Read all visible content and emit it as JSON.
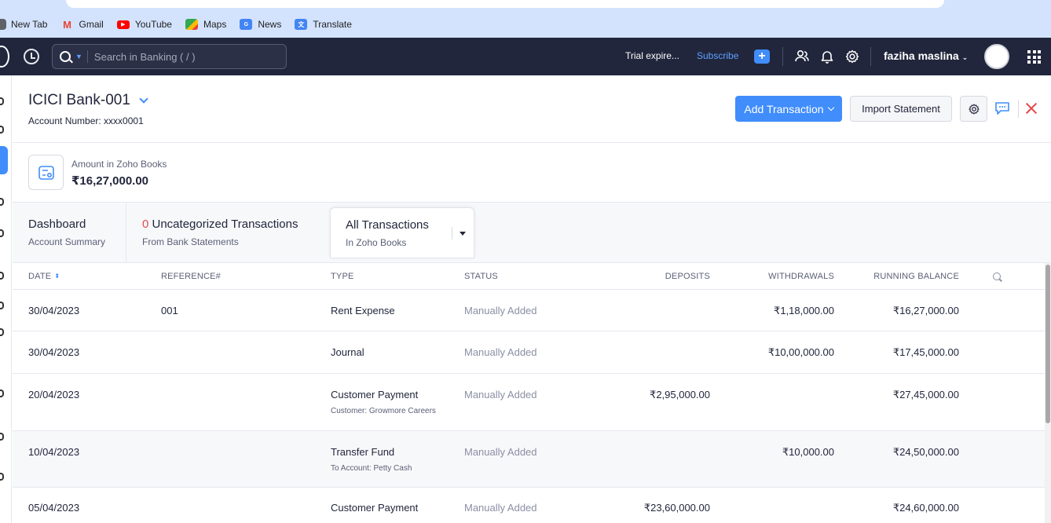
{
  "browser": {
    "bookmarks": [
      {
        "label": "New Tab",
        "icon": "globe-icon",
        "color": "#5f6368"
      },
      {
        "label": "Gmail",
        "icon": "gmail-icon",
        "color": "#ea4335"
      },
      {
        "label": "YouTube",
        "icon": "youtube-icon",
        "color": "#ff0000"
      },
      {
        "label": "Maps",
        "icon": "maps-icon",
        "color": "#34a853"
      },
      {
        "label": "News",
        "icon": "news-icon",
        "color": "#4285f4"
      },
      {
        "label": "Translate",
        "icon": "translate-icon",
        "color": "#4285f4"
      }
    ]
  },
  "topbar": {
    "search_placeholder": "Search in Banking ( / )",
    "trial_text": "Trial expire...",
    "subscribe_label": "Subscribe",
    "plus_label": "+",
    "user_name": "faziha maslina",
    "colors": {
      "bar": "#21263c",
      "accent": "#408dfb"
    }
  },
  "account": {
    "title": "ICICI Bank-001",
    "number_label": "Account Number: xxxx0001",
    "add_transaction_label": "Add Transaction",
    "import_statement_label": "Import Statement",
    "amount_label": "Amount in Zoho Books",
    "amount_value": "₹16,27,000.00"
  },
  "tabs": [
    {
      "title": "Dashboard",
      "subtitle": "Account Summary"
    },
    {
      "count": "0",
      "title": " Uncategorized Transactions",
      "subtitle": "From Bank Statements"
    },
    {
      "title": "All Transactions",
      "subtitle": "In Zoho Books"
    }
  ],
  "table": {
    "columns": [
      "DATE",
      "REFERENCE#",
      "TYPE",
      "STATUS",
      "DEPOSITS",
      "WITHDRAWALS",
      "RUNNING BALANCE"
    ],
    "rows": [
      {
        "date": "30/04/2023",
        "reference": "001",
        "type": "Rent Expense",
        "sub": "",
        "status": "Manually Added",
        "deposits": "",
        "withdrawals": "₹1,18,000.00",
        "balance": "₹16,27,000.00"
      },
      {
        "date": "30/04/2023",
        "reference": "",
        "type": "Journal",
        "sub": "",
        "status": "Manually Added",
        "deposits": "",
        "withdrawals": "₹10,00,000.00",
        "balance": "₹17,45,000.00"
      },
      {
        "date": "20/04/2023",
        "reference": "",
        "type": "Customer Payment",
        "sub": "Customer: Growmore Careers",
        "status": "Manually Added",
        "deposits": "₹2,95,000.00",
        "withdrawals": "",
        "balance": "₹27,45,000.00"
      },
      {
        "date": "10/04/2023",
        "reference": "",
        "type": "Transfer Fund",
        "sub": "To Account: Petty Cash",
        "status": "Manually Added",
        "deposits": "",
        "withdrawals": "₹10,000.00",
        "balance": "₹24,50,000.00"
      },
      {
        "date": "05/04/2023",
        "reference": "",
        "type": "Customer Payment",
        "sub": "",
        "status": "Manually Added",
        "deposits": "₹23,60,000.00",
        "withdrawals": "",
        "balance": "₹24,60,000.00"
      }
    ]
  }
}
